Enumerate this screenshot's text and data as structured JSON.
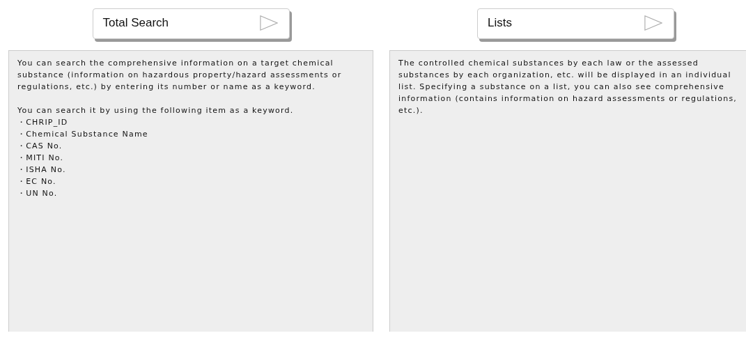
{
  "columns": [
    {
      "button": {
        "label": "Total Search"
      },
      "paragraphs": [
        "You can search the comprehensive information on a target chemical substance (information on hazardous property/hazard assessments or regulations, etc.) by entering its number or name as a keyword.",
        "You can search it by using the following item as a keyword."
      ],
      "items": [
        "・CHRIP_ID",
        "・Chemical Substance Name",
        "・CAS No.",
        "・MITI No.",
        "・ISHA No.",
        "・EC No.",
        "・UN No."
      ]
    },
    {
      "button": {
        "label": "Lists"
      },
      "paragraphs": [
        "The controlled chemical substances by each law or the assessed substances by each organization, etc. will be displayed in an individual list. Specifying a substance on a list, you can also see comprehensive information (contains information on hazard assessments or regulations, etc.)."
      ]
    }
  ]
}
